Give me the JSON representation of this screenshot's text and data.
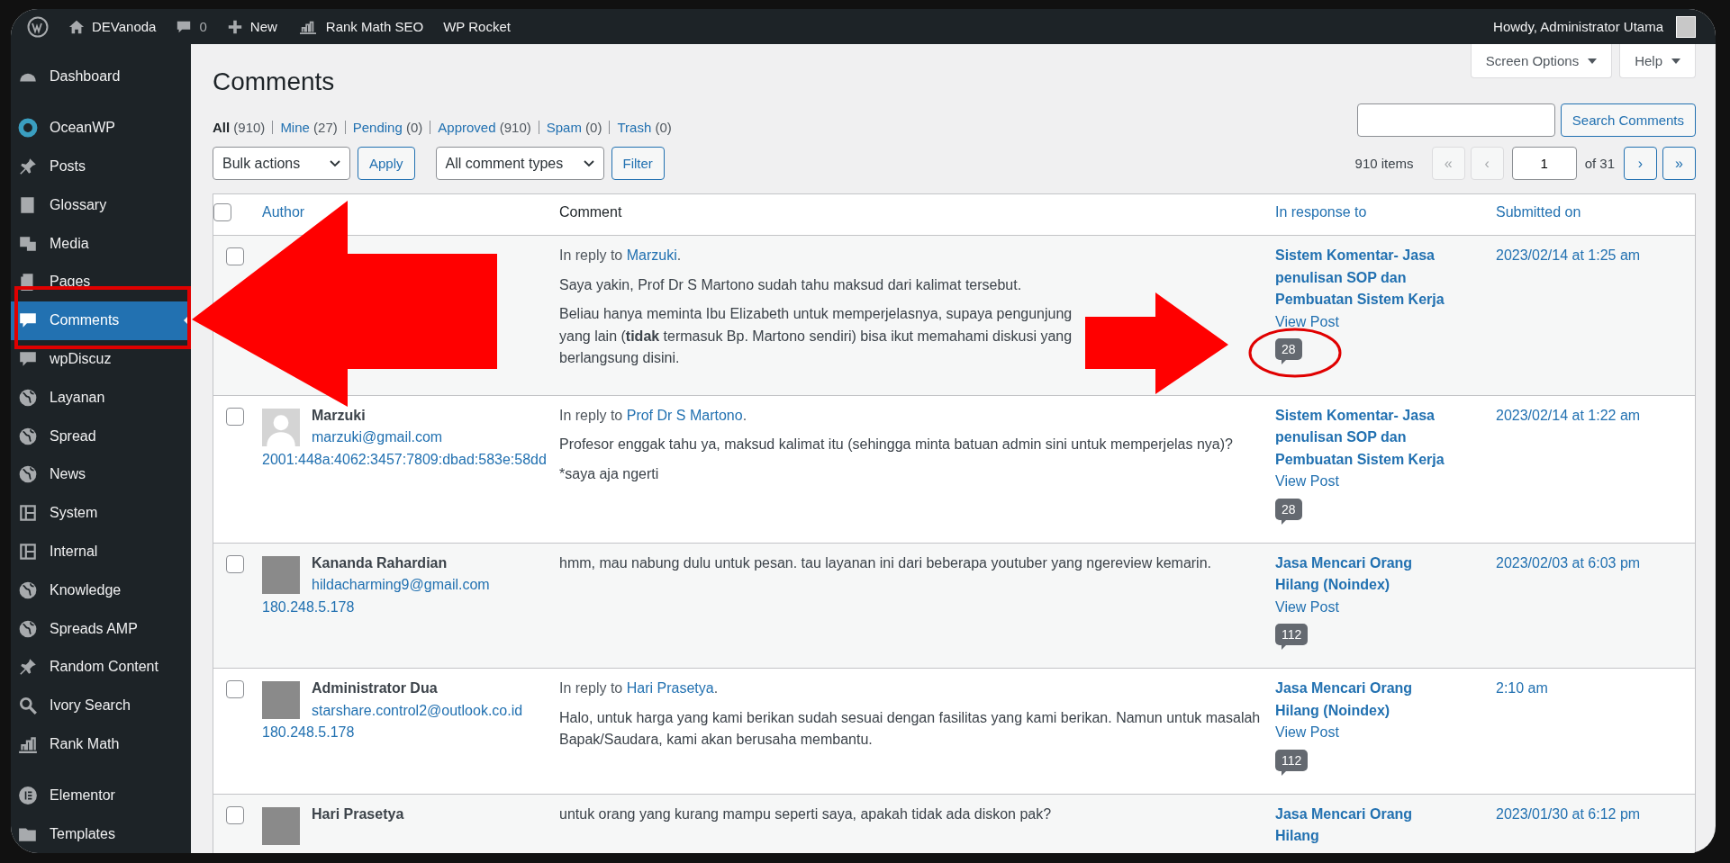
{
  "top_bar": {
    "site": "DEVanoda",
    "comments": "0",
    "new": "New",
    "rank_math": "Rank Math SEO",
    "wp_rocket": "WP Rocket",
    "greeting": "Howdy, Administrator Utama"
  },
  "sidebar": {
    "groups": [
      [
        {
          "label": "Dashboard",
          "selected": false
        }
      ],
      [
        {
          "label": "OceanWP",
          "selected": false
        },
        {
          "label": "Posts",
          "selected": false
        },
        {
          "label": "Glossary",
          "selected": false
        },
        {
          "label": "Media",
          "selected": false
        },
        {
          "label": "Pages",
          "selected": false
        },
        {
          "label": "Comments",
          "selected": true
        },
        {
          "label": "wpDiscuz",
          "selected": false
        },
        {
          "label": "Layanan",
          "selected": false
        },
        {
          "label": "Spread",
          "selected": false
        },
        {
          "label": "News",
          "selected": false
        },
        {
          "label": "System",
          "selected": false
        },
        {
          "label": "Internal",
          "selected": false
        },
        {
          "label": "Knowledge",
          "selected": false
        },
        {
          "label": "Spreads AMP",
          "selected": false
        },
        {
          "label": "Random Content",
          "selected": false
        },
        {
          "label": "Ivory Search",
          "selected": false
        },
        {
          "label": "Rank Math",
          "selected": false
        }
      ],
      [
        {
          "label": "Elementor",
          "selected": false
        },
        {
          "label": "Templates",
          "selected": false
        }
      ]
    ]
  },
  "screen_meta": [
    "Screen Options",
    "Help"
  ],
  "title": "Comments",
  "filters": [
    {
      "label": "All",
      "count": "(910)",
      "selected": true
    },
    {
      "label": "Mine",
      "count": "(27)",
      "selected": false
    },
    {
      "label": "Pending",
      "count": "(0)",
      "selected": false
    },
    {
      "label": "Approved",
      "count": "(910)",
      "selected": false
    },
    {
      "label": "Spam",
      "count": "(0)",
      "selected": false
    },
    {
      "label": "Trash",
      "count": "(0)",
      "selected": false
    }
  ],
  "search": {
    "button": "Search Comments"
  },
  "bulk": {
    "select": "Bulk actions",
    "apply": "Apply",
    "types": "All comment types",
    "filter": "Filter"
  },
  "pagination": {
    "items": "910 items",
    "first": {
      "label": "«",
      "disabled": true
    },
    "prev": {
      "label": "‹",
      "disabled": true
    },
    "page": "1",
    "of": "of 31",
    "next": {
      "label": "›",
      "disabled": false
    },
    "last": {
      "label": "»",
      "disabled": false
    }
  },
  "table": {
    "select_all_checked": false,
    "columns": [
      {
        "label": "Author",
        "sortable": true
      },
      {
        "label": "Comment",
        "sortable": false
      },
      {
        "label": "In response to",
        "sortable": true
      },
      {
        "label": "Submitted on",
        "sortable": true
      }
    ],
    "rows": [
      {
        "checked": false,
        "comment": {
          "reply": {
            "prefix": "In reply to",
            "name": "Marzuki",
            "suffix": "."
          },
          "paragraphs": [
            "Saya yakin, Prof Dr S Martono sudah tahu maksud dari kalimat tersebut.",
            "Beliau hanya meminta Ibu Elizabeth untuk memperjelasnya, supaya pengunjung yang lain (**tidak** termasuk Bp. Martono sendiri) bisa ikut memahami diskusi yang berlangsung disini."
          ]
        },
        "response": {
          "title": "Sistem Komentar- Jasa penulisan SOP dan Pembuatan Sistem Kerja",
          "view": "View Post",
          "count": "28"
        },
        "date": "2023/02/14 at 1:25 am"
      },
      {
        "checked": false,
        "author": {
          "kind": "silhouette",
          "name": "Marzuki",
          "email": "marzuki@gmail.com",
          "ip": "2001:448a:4062:3457:7809:dbad:583e:58dd"
        },
        "comment": {
          "reply": {
            "prefix": "In reply to",
            "name": "Prof Dr S Martono",
            "suffix": "."
          },
          "paragraphs": [
            "Profesor enggak tahu ya, maksud kalimat itu (sehingga minta batuan admin sini untuk memperjelas nya)?",
            "*saya aja ngerti"
          ]
        },
        "response": {
          "title": "Sistem Komentar- Jasa penulisan SOP dan Pembuatan Sistem Kerja",
          "view": "View Post",
          "count": "28"
        },
        "date": "2023/02/14 at 1:22 am"
      },
      {
        "checked": false,
        "author": {
          "kind": "photo",
          "name": "Kananda Rahardian",
          "email": "hildacharming9@gmail.com",
          "ip": "180.248.5.178"
        },
        "comment": {
          "paragraphs": [
            "hmm, mau nabung dulu untuk pesan. tau layanan ini dari beberapa youtuber yang ngereview kemarin."
          ]
        },
        "response": {
          "title": "Jasa Mencari Orang Hilang (Noindex)",
          "view": "View Post",
          "count": "112"
        },
        "date": "2023/02/03 at 6:03 pm"
      },
      {
        "checked": false,
        "author": {
          "kind": "photo",
          "name": "Administrator Dua",
          "email": "starshare.control2@outlook.co.id",
          "ip": "180.248.5.178"
        },
        "comment": {
          "reply": {
            "prefix": "In reply to",
            "name": "Hari Prasetya",
            "suffix": "."
          },
          "paragraphs": [
            "Halo, untuk harga yang kami berikan sudah sesuai dengan fasilitas yang kami berikan. Namun untuk masalah Bapak/Saudara, kami akan berusaha membantu."
          ]
        },
        "response": {
          "title": "Jasa Mencari Orang Hilang (Noindex)",
          "view": "View Post",
          "count": "112"
        },
        "date": "2:10 am"
      },
      {
        "checked": false,
        "author": {
          "kind": "photo",
          "name": "Hari Prasetya"
        },
        "comment": {
          "paragraphs": [
            "untuk orang yang kurang mampu seperti saya, apakah tidak ada diskon pak?"
          ]
        },
        "response": {
          "title": "Jasa Mencari Orang Hilang"
        },
        "date": "2023/01/30 at 6:12 pm"
      }
    ]
  }
}
